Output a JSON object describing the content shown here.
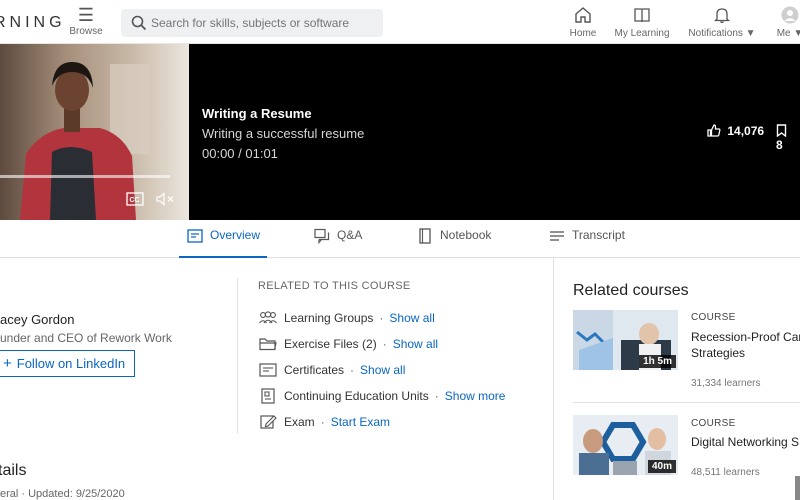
{
  "nav": {
    "brand": "RNING",
    "browse_label": "Browse",
    "search_placeholder": "Search for skills, subjects or software",
    "home_label": "Home",
    "my_learning_label": "My Learning",
    "notifications_label": "Notifications",
    "me_label": "Me"
  },
  "player": {
    "title": "Writing a Resume",
    "subtitle": "Writing a successful resume",
    "time": "00:00 / 01:01",
    "likes": "14,076",
    "saves": "8"
  },
  "tabs": [
    {
      "label": "Overview",
      "icon": "overview-icon",
      "active": true
    },
    {
      "label": "Q&A",
      "icon": "qa-icon",
      "active": false
    },
    {
      "label": "Notebook",
      "icon": "notebook-icon",
      "active": false
    },
    {
      "label": "Transcript",
      "icon": "transcript-icon",
      "active": false
    }
  ],
  "author": {
    "name": "acey Gordon",
    "role": "under and CEO of Rework Work",
    "follow_label": "Follow on LinkedIn"
  },
  "details": {
    "heading": "tails",
    "meta": "eral  ·  Updated: 9/25/2020"
  },
  "related_to_course": {
    "title": "RELATED TO THIS COURSE",
    "items": [
      {
        "label": "Learning Groups",
        "link": "Show all",
        "icon": "groups-icon"
      },
      {
        "label": "Exercise Files (2)",
        "link": "Show all",
        "icon": "folder-icon"
      },
      {
        "label": "Certificates",
        "link": "Show all",
        "icon": "certificate-icon"
      },
      {
        "label": "Continuing Education Units",
        "link": "Show more",
        "icon": "ceu-icon"
      },
      {
        "label": "Exam",
        "link": "Start Exam",
        "icon": "exam-icon"
      }
    ]
  },
  "related_courses": {
    "title": "Related courses",
    "items": [
      {
        "kind": "COURSE",
        "name": "Recession-Proof Care\nStrategies",
        "duration": "1h 5m",
        "learners": "31,334 learners"
      },
      {
        "kind": "COURSE",
        "name": "Digital Networking S",
        "duration": "40m",
        "learners": "48,511 learners"
      }
    ]
  }
}
